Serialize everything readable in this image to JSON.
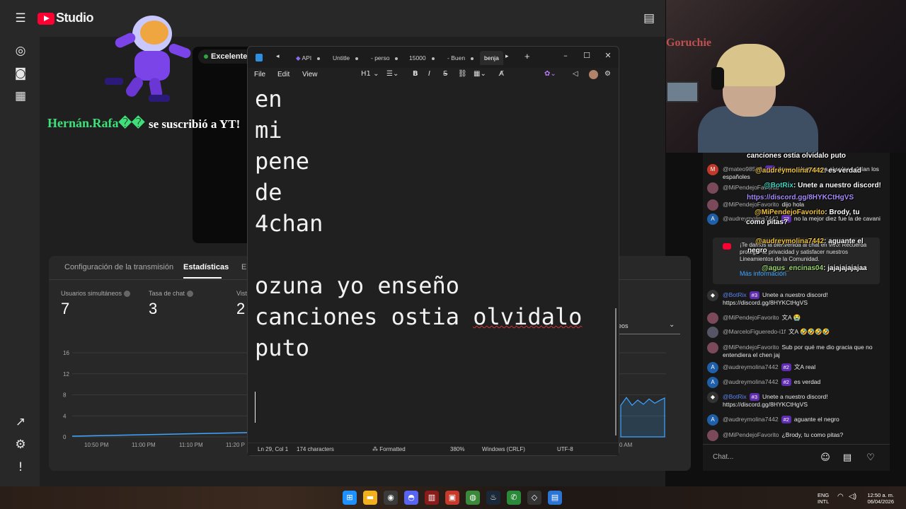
{
  "studio": {
    "logo_text": "Studio",
    "quality": "Excelente",
    "alert_name": "Hernán.Rafa��",
    "alert_msg": "se suscribió a YT!",
    "tabs": [
      "Configuración de la transmisión",
      "Estadísticas",
      "En"
    ],
    "metrics": [
      {
        "label": "Usuarios simultáneos",
        "value": "7"
      },
      {
        "label": "Tasa de chat",
        "value": "3"
      },
      {
        "label": "Vist",
        "value": "2"
      }
    ],
    "dropdown_label": "eos",
    "chart_data": {
      "type": "line",
      "x": [
        "10:50 PM",
        "11:00 PM",
        "11:10 PM",
        "11:20 P"
      ],
      "y_ticks": [
        0,
        4,
        8,
        12,
        16
      ],
      "right_x_label": "0 AM",
      "ylim": [
        0,
        16
      ]
    }
  },
  "notepad": {
    "tabs": [
      "API",
      "Untitle",
      "- perso",
      "15000",
      "- Buen",
      "benja"
    ],
    "menu": [
      "File",
      "Edit",
      "View"
    ],
    "heading_tool": "H1",
    "lines": [
      "en",
      "mi",
      "pene",
      "de",
      "4chan",
      "",
      "ozuna yo enseño"
    ],
    "line_canciones_a": "canciones ostia ",
    "line_canciones_b": "olvidalo",
    "line_last": "puto",
    "status": {
      "position": "Ln 29, Col 1",
      "chars": "174 characters",
      "format": "Formatted",
      "zoom": "380%",
      "eol": "Windows (CRLF)",
      "encoding": "UTF-8"
    }
  },
  "webcam": {
    "sign": "Goruchie"
  },
  "chat": {
    "overlay": [
      {
        "name": "",
        "text": "canciones ostia olvidalo puto"
      },
      {
        "name": "@audreymolina7442",
        "text": ": es verdad"
      },
      {
        "name": "@BotRix",
        "text": ": Unete a nuestro discord!"
      },
      {
        "name": "",
        "text": "https://discord.gg/8HYKCtHgVS"
      },
      {
        "name": "@MiPendejoFavorito",
        "text": ": Brody, tu"
      },
      {
        "name": "",
        "text": "como pitas?"
      },
      {
        "name": "@audreymolina7442",
        "text": ": aguante el"
      },
      {
        "name": "",
        "text": "negro"
      },
      {
        "name": "@agus_encinas04",
        "text": ": jajajajajajaa"
      }
    ],
    "messages_top": [
      {
        "author": "@mateo98500",
        "badge": "#1",
        "text": "tienes talento para el salseo dirían los españoles",
        "avatar": "M",
        "color": "#c0392b"
      },
      {
        "author": "@MiPendejoFavorito",
        "badge": "",
        "text": "",
        "avatar": "",
        "color": "#7a4a5a"
      },
      {
        "author": "@MiPendejoFavorito",
        "badge": "",
        "text": "dijo hola",
        "avatar": "",
        "color": "#7a4a5a"
      },
      {
        "author": "@audreymolina7442",
        "badge": "#2",
        "text": "no la mejor diez fue la de cavani",
        "avatar": "A",
        "color": "#1e5fa8"
      }
    ],
    "welcome": "¡Te damos la bienvenida al chat en vivo! Recuerda proteger tu privacidad y satisfacer nuestros Lineamientos de la Comunidad.",
    "more_info": "Más información",
    "messages": [
      {
        "author": "@BotRix",
        "badge": "#3",
        "text": "Unete a nuestro discord! https://discord.gg/8HYKCtHgVS",
        "avatar": "◆",
        "color": "#333",
        "mod": true
      },
      {
        "author": "@MiPendejoFavorito",
        "badge": "",
        "text": "文A 😭",
        "avatar": "",
        "color": "#7a4a5a",
        "mod": false
      },
      {
        "author": "@MarceloFigueredo-i1f",
        "badge": "",
        "text": "文A 🤣🤣🤣🤣",
        "avatar": "",
        "color": "#556",
        "mod": false
      },
      {
        "author": "@MiPendejoFavorito",
        "badge": "",
        "text": "Sub por qué me dio gracia que no entendiera el chen jaj",
        "avatar": "",
        "color": "#7a4a5a",
        "mod": false
      },
      {
        "author": "@audreymolina7442",
        "badge": "#2",
        "text": "文A real",
        "avatar": "A",
        "color": "#1e5fa8",
        "mod": false
      },
      {
        "author": "@audreymolina7442",
        "badge": "#2",
        "text": "es verdad",
        "avatar": "A",
        "color": "#1e5fa8",
        "mod": false
      },
      {
        "author": "@BotRix",
        "badge": "#3",
        "text": "Unete a nuestro discord! https://discord.gg/8HYKCtHgVS",
        "avatar": "◆",
        "color": "#333",
        "mod": true
      },
      {
        "author": "@audreymolina7442",
        "badge": "#2",
        "text": "aguante el negro",
        "avatar": "A",
        "color": "#1e5fa8",
        "mod": false
      },
      {
        "author": "@MiPendejoFavorito",
        "badge": "",
        "text": "¿Brody, tu como pitas?",
        "avatar": "",
        "color": "#7a4a5a",
        "mod": false
      }
    ],
    "input_placeholder": "Chat..."
  },
  "taskbar": {
    "lang": "ENG",
    "layout": "INTL",
    "time": "12:50 a. m.",
    "date": "06/04/2026"
  }
}
